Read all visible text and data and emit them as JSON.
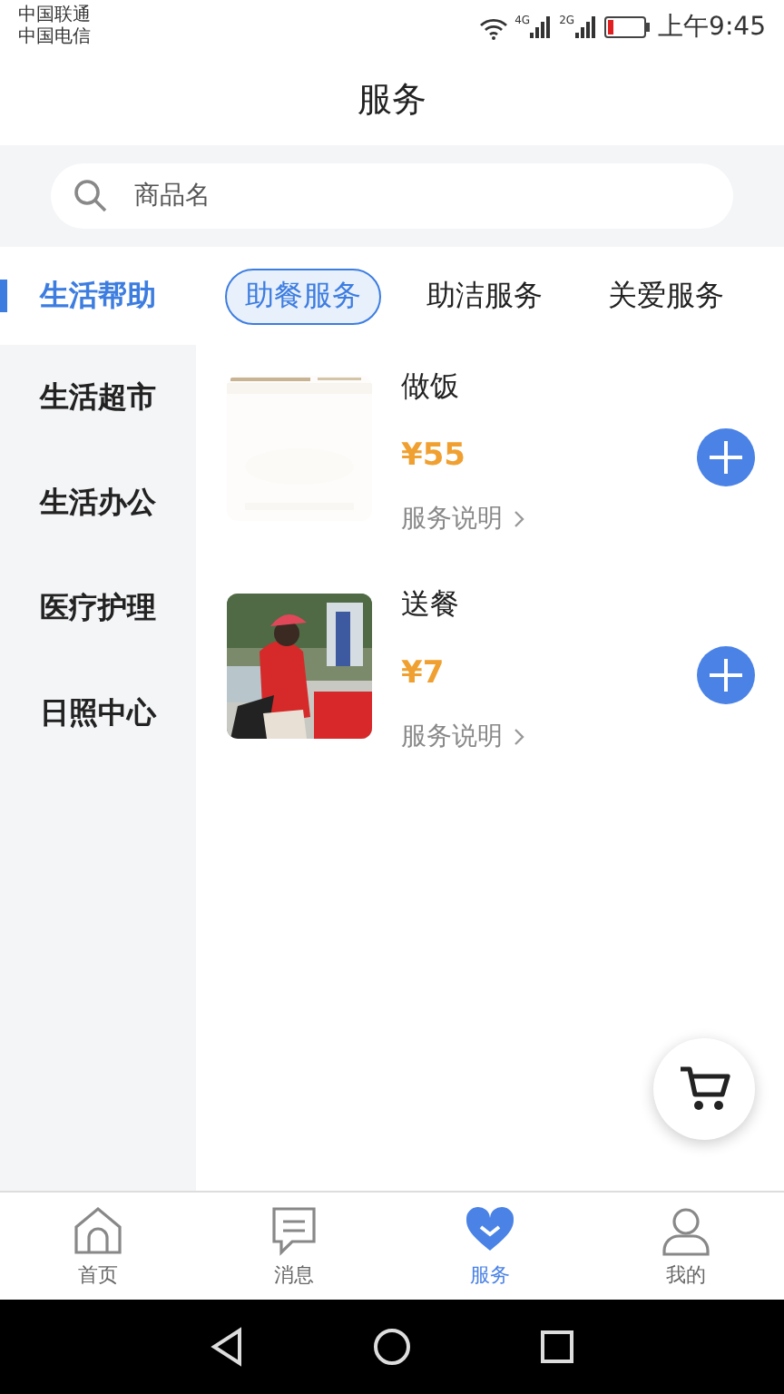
{
  "status_bar": {
    "carriers": [
      "中国联通",
      "中国电信"
    ],
    "networks": [
      "4G",
      "2G"
    ],
    "time": "上午9:45"
  },
  "header": {
    "title": "服务"
  },
  "search": {
    "placeholder": "商品名"
  },
  "sidebar": {
    "items": [
      {
        "label": "生活帮助",
        "selected": true
      },
      {
        "label": "生活超市",
        "selected": false
      },
      {
        "label": "生活办公",
        "selected": false
      },
      {
        "label": "医疗护理",
        "selected": false
      },
      {
        "label": "日照中心",
        "selected": false
      }
    ]
  },
  "subtabs": [
    {
      "label": "助餐服务",
      "selected": true
    },
    {
      "label": "助洁服务",
      "selected": false
    },
    {
      "label": "关爱服务",
      "selected": false
    }
  ],
  "products": [
    {
      "name": "做饭",
      "price": "¥55",
      "info_link": "服务说明"
    },
    {
      "name": "送餐",
      "price": "¥7",
      "info_link": "服务说明"
    }
  ],
  "bottom_nav": [
    {
      "label": "首页",
      "kind": "home",
      "selected": false
    },
    {
      "label": "消息",
      "kind": "message",
      "selected": false
    },
    {
      "label": "服务",
      "kind": "service",
      "selected": true
    },
    {
      "label": "我的",
      "kind": "profile",
      "selected": false
    }
  ]
}
